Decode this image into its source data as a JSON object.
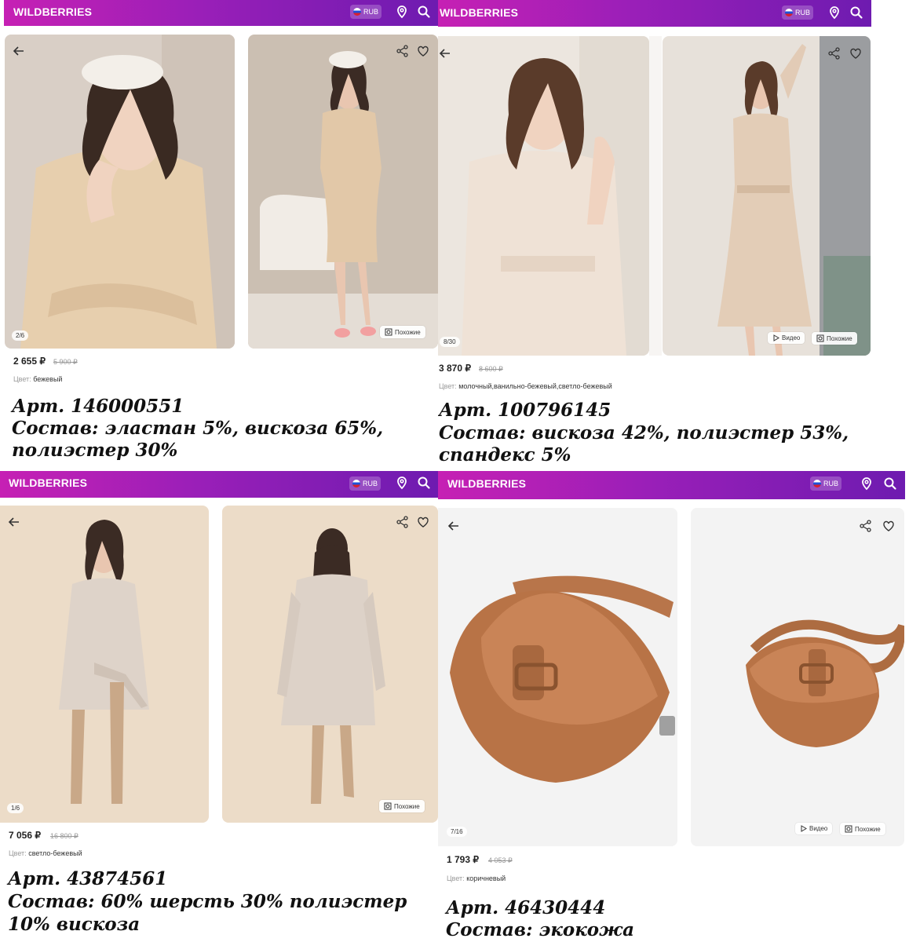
{
  "colors": {
    "accent_left": "#c620b4",
    "accent_right": "#6e1bb0",
    "text": "#222222",
    "muted": "#999999"
  },
  "icons": [
    "back-arrow-icon",
    "share-icon",
    "heart-icon",
    "location-pin-icon",
    "search-icon",
    "similar-icon",
    "video-play-icon",
    "russian-flag-icon"
  ],
  "cards": [
    {
      "brand": "WILDBERRIES",
      "currency": "RUB",
      "counter": "2/6",
      "similar": "Похожие",
      "price": "2 655 ₽",
      "old_price": "5 900 ₽",
      "color_label": "Цвет:",
      "color_value": "бежевый",
      "art": "Арт. 146000551",
      "composition_1": "Состав: эластан 5%, вискоза 65%,",
      "composition_2": "полиэстер 30%"
    },
    {
      "brand": "WILDBERRIES",
      "currency": "RUB",
      "counter": "8/30",
      "video": "Видео",
      "similar": "Похожие",
      "price": "3 870 ₽",
      "old_price": "8 600 ₽",
      "color_label": "Цвет:",
      "color_value": "молочный,ванильно-бежевый,светло-бежевый",
      "art": "Арт. 100796145",
      "composition_1": "Состав: вискоза 42%, полиэстер 53%,",
      "composition_2": "спандекс 5%"
    },
    {
      "brand": "WILDBERRIES",
      "currency": "RUB",
      "counter": "1/6",
      "similar": "Похожие",
      "price": "7 056 ₽",
      "old_price": "16 800 ₽",
      "color_label": "Цвет:",
      "color_value": "светло-бежевый",
      "art": "Арт. 43874561",
      "composition_1": "Состав: 60% шерсть 30% полиэстер",
      "composition_2": "10% вискоза"
    },
    {
      "brand": "WILDBERRIES",
      "currency": "RUB",
      "counter": "7/16",
      "video": "Видео",
      "similar": "Похожие",
      "price": "1 793 ₽",
      "old_price": "4 053 ₽",
      "color_label": "Цвет:",
      "color_value": "коричневый",
      "art": "Арт. 46430444",
      "composition_1": "Состав: экокожа"
    }
  ]
}
